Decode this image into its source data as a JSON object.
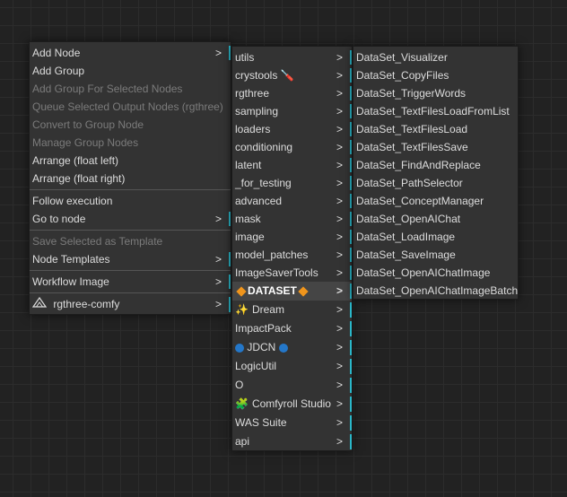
{
  "main_menu": {
    "items": [
      {
        "label": "Add Node",
        "disabled": false,
        "submenu": true
      },
      {
        "label": "Add Group",
        "disabled": false,
        "submenu": false
      },
      {
        "label": "Add Group For Selected Nodes",
        "disabled": true,
        "submenu": false
      },
      {
        "label": "Queue Selected Output Nodes (rgthree)",
        "disabled": true,
        "submenu": false
      },
      {
        "label": "Convert to Group Node",
        "disabled": true,
        "submenu": false
      },
      {
        "label": "Manage Group Nodes",
        "disabled": true,
        "submenu": false
      },
      {
        "label": "Arrange (float left)",
        "disabled": false,
        "submenu": false
      },
      {
        "label": "Arrange (float right)",
        "disabled": false,
        "submenu": false
      },
      {
        "label": "Follow execution",
        "disabled": false,
        "submenu": false
      },
      {
        "label": "Go to node",
        "disabled": false,
        "submenu": true
      },
      {
        "label": "Save Selected as Template",
        "disabled": true,
        "submenu": false
      },
      {
        "label": "Node Templates",
        "disabled": false,
        "submenu": true
      },
      {
        "label": "Workflow Image",
        "disabled": false,
        "submenu": true
      },
      {
        "label": "rgthree-comfy",
        "disabled": false,
        "submenu": true
      }
    ],
    "arrow": ">"
  },
  "category_menu": {
    "items": [
      {
        "label": "utils"
      },
      {
        "label": "crystools 🪛"
      },
      {
        "label": "rgthree"
      },
      {
        "label": "sampling"
      },
      {
        "label": "loaders"
      },
      {
        "label": "conditioning"
      },
      {
        "label": "latent"
      },
      {
        "label": "_for_testing"
      },
      {
        "label": "advanced"
      },
      {
        "label": "mask"
      },
      {
        "label": "image"
      },
      {
        "label": "model_patches"
      },
      {
        "label": "ImageSaverTools"
      },
      {
        "label": "DATASET"
      },
      {
        "label": "Dream"
      },
      {
        "label": "ImpactPack"
      },
      {
        "label": "JDCN"
      },
      {
        "label": "LogicUtil"
      },
      {
        "label": "O"
      },
      {
        "label": "Comfyroll Studio"
      },
      {
        "label": "WAS Suite"
      },
      {
        "label": "api"
      }
    ],
    "dream_icon": "✨",
    "comfyroll_icon": "🧩",
    "active_item": "DATASET",
    "arrow": ">"
  },
  "dataset_menu": {
    "items": [
      "DataSet_Visualizer",
      "DataSet_CopyFiles",
      "DataSet_TriggerWords",
      "DataSet_TextFilesLoadFromList",
      "DataSet_TextFilesLoad",
      "DataSet_TextFilesSave",
      "DataSet_FindAndReplace",
      "DataSet_PathSelector",
      "DataSet_ConceptManager",
      "DataSet_OpenAIChat",
      "DataSet_LoadImage",
      "DataSet_SaveImage",
      "DataSet_OpenAIChatImage",
      "DataSet_OpenAIChatImageBatch"
    ]
  },
  "colors": {
    "background": "#222222",
    "menu_bg": "#333333",
    "text": "#dddddd",
    "disabled_text": "#7b7b7b",
    "submenu_marker": "#2ab7c9",
    "highlight_bg": "#454545"
  }
}
